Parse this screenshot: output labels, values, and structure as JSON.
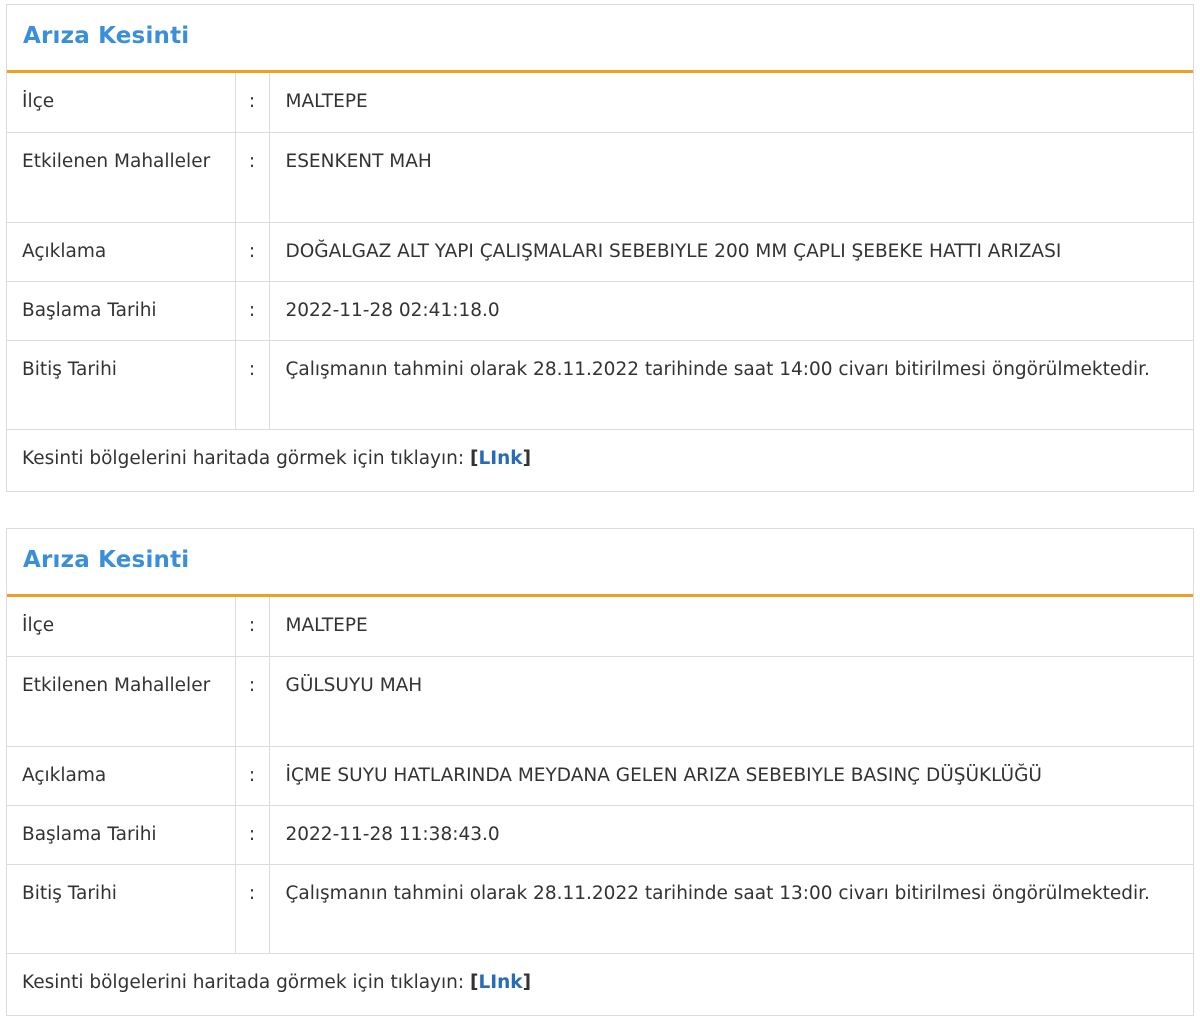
{
  "outages": [
    {
      "title": "Arıza Kesinti",
      "rows": {
        "district_label": "İlçe",
        "district_value": "MALTEPE",
        "neighborhoods_label": "Etkilenen Mahalleler",
        "neighborhoods_value": "ESENKENT MAH",
        "description_label": "Açıklama",
        "description_value": "DOĞALGAZ ALT YAPI ÇALIŞMALARI SEBEBIYLE 200 MM ÇAPLI ŞEBEKE HATTI ARIZASI",
        "start_label": "Başlama Tarihi",
        "start_value": "2022-11-28 02:41:18.0",
        "end_label": "Bitiş Tarihi",
        "end_value": "Çalışmanın tahmini olarak 28.11.2022 tarihinde saat 14:00 civarı bitirilmesi öngörülmektedir."
      },
      "separator": ":",
      "footer_text": "Kesinti bölgelerini haritada görmek için tıklayın: ",
      "link_label": "LInk"
    },
    {
      "title": "Arıza Kesinti",
      "rows": {
        "district_label": "İlçe",
        "district_value": "MALTEPE",
        "neighborhoods_label": "Etkilenen Mahalleler",
        "neighborhoods_value": "GÜLSUYU MAH",
        "description_label": "Açıklama",
        "description_value": "İÇME SUYU HATLARINDA MEYDANA GELEN ARIZA SEBEBIYLE BASINÇ DÜŞÜKLÜĞÜ",
        "start_label": "Başlama Tarihi",
        "start_value": "2022-11-28 11:38:43.0",
        "end_label": "Bitiş Tarihi",
        "end_value": "Çalışmanın tahmini olarak 28.11.2022 tarihinde saat 13:00 civarı bitirilmesi öngörülmektedir."
      },
      "separator": ":",
      "footer_text": "Kesinti bölgelerini haritada görmek için tıklayın: ",
      "link_label": "LInk"
    }
  ],
  "colors": {
    "title": "#3a8fd9",
    "header_rule": "#f0a020",
    "link": "#2a6bb5",
    "border": "#dcdcdc"
  }
}
